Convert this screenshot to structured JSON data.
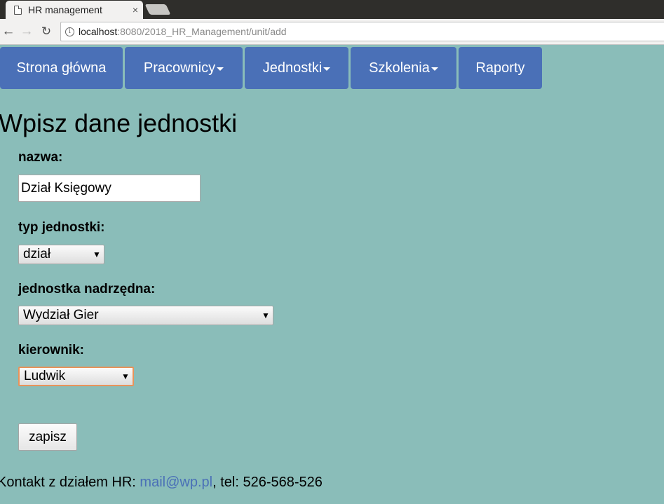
{
  "browser": {
    "tab_title": "HR management",
    "tab_close": "×",
    "url_host": "localhost",
    "url_rest": ":8080/2018_HR_Management/unit/add"
  },
  "nav": {
    "items": [
      {
        "label": "Strona główna",
        "dropdown": false
      },
      {
        "label": "Pracownicy",
        "dropdown": true
      },
      {
        "label": "Jednostki",
        "dropdown": true
      },
      {
        "label": "Szkolenia",
        "dropdown": true
      },
      {
        "label": "Raporty",
        "dropdown": false
      }
    ]
  },
  "form": {
    "title": "Wpisz dane jednostki",
    "name_label": "nazwa:",
    "name_value": "Dział Księgowy",
    "type_label": "typ jednostki:",
    "type_value": "dział",
    "parent_label": "jednostka nadrzędna:",
    "parent_value": "Wydział Gier",
    "manager_label": "kierownik:",
    "manager_value": "Ludwik",
    "submit_label": "zapisz"
  },
  "footer": {
    "prefix": "Kontakt z działem HR: ",
    "email": "mail@wp.pl",
    "suffix": ", tel: 526-568-526"
  },
  "colors": {
    "page_bg": "#8abdb9",
    "nav_bg": "#4a70b7",
    "link": "#4a70b7",
    "focus_border": "#e8935a"
  }
}
